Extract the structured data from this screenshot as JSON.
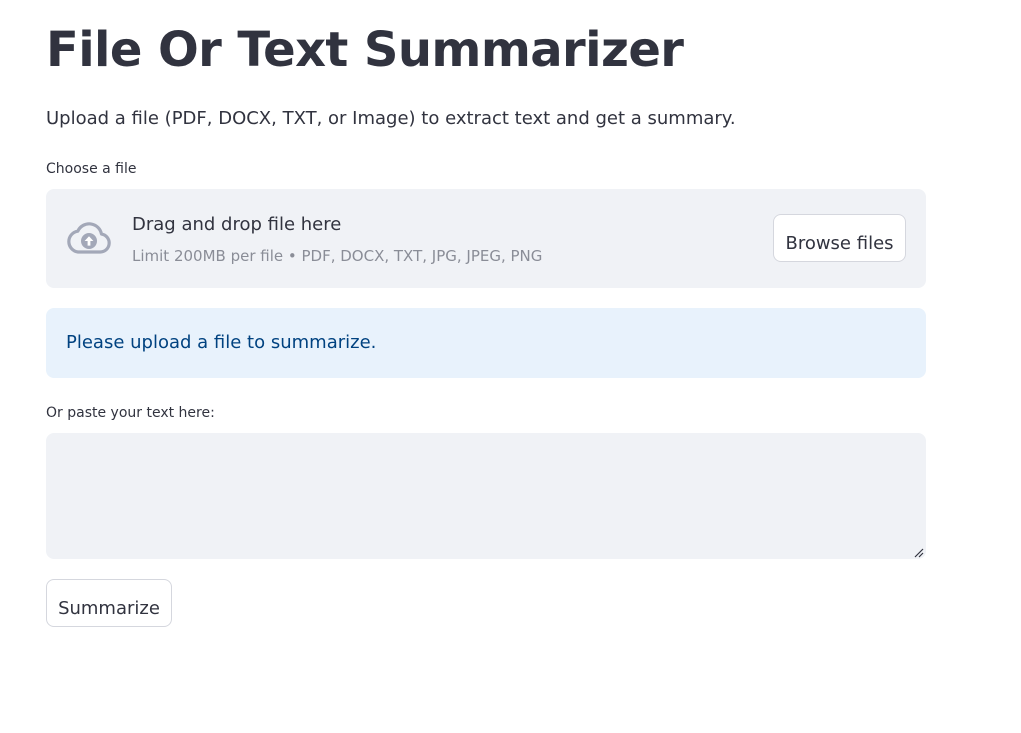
{
  "title": "File Or Text Summarizer",
  "subtitle": "Upload a file (PDF, DOCX, TXT, or Image) to extract text and get a summary.",
  "uploader": {
    "label": "Choose a file",
    "icon": "cloud-upload-icon",
    "drag_text": "Drag and drop file here",
    "limit_text": "Limit 200MB per file • PDF, DOCX, TXT, JPG, JPEG, PNG",
    "browse_label": "Browse files"
  },
  "info": {
    "message": "Please upload a file to summarize."
  },
  "text_input": {
    "label": "Or paste your text here:",
    "value": "",
    "placeholder": ""
  },
  "actions": {
    "summarize_label": "Summarize"
  },
  "colors": {
    "text": "#31333f",
    "muted": "#8a8d97",
    "surface": "#f0f2f6",
    "info_bg": "#e8f2fc",
    "info_text": "#004280",
    "icon": "#a3a8b8"
  }
}
